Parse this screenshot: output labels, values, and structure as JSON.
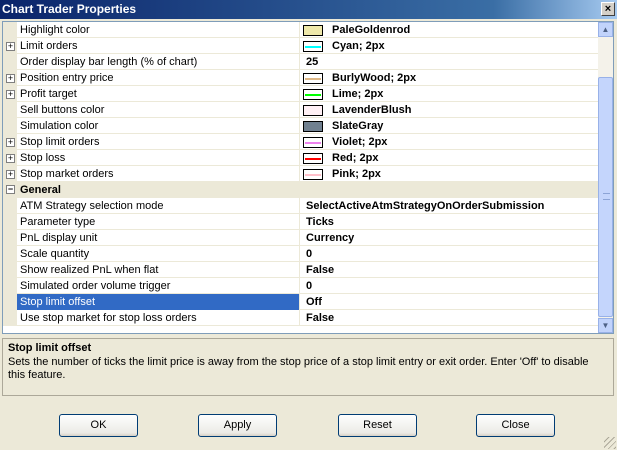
{
  "window": {
    "title": "Chart Trader Properties",
    "close_glyph": "×"
  },
  "grid": {
    "rows": [
      {
        "name": "Highlight color",
        "value": "PaleGoldenrod",
        "swatch": "#eee8aa",
        "line": null,
        "expander": ""
      },
      {
        "name": "Limit orders",
        "value": "Cyan; 2px",
        "swatch": "#ffffff",
        "line": "#00ffff",
        "expander": "+"
      },
      {
        "name": "Order display bar length (% of chart)",
        "value": "25",
        "swatch": null,
        "line": null,
        "expander": ""
      },
      {
        "name": "Position entry price",
        "value": "BurlyWood; 2px",
        "swatch": "#ffffff",
        "line": "#deb887",
        "expander": "+"
      },
      {
        "name": "Profit target",
        "value": "Lime; 2px",
        "swatch": "#ffffff",
        "line": "#00ff00",
        "expander": "+"
      },
      {
        "name": "Sell buttons color",
        "value": "LavenderBlush",
        "swatch": "#fff0f5",
        "line": null,
        "expander": ""
      },
      {
        "name": "Simulation color",
        "value": "SlateGray",
        "swatch": "#708090",
        "line": null,
        "expander": ""
      },
      {
        "name": "Stop limit orders",
        "value": "Violet; 2px",
        "swatch": "#ffffff",
        "line": "#ee82ee",
        "expander": "+"
      },
      {
        "name": "Stop loss",
        "value": "Red; 2px",
        "swatch": "#ffffff",
        "line": "#ff0000",
        "expander": "+"
      },
      {
        "name": "Stop market orders",
        "value": "Pink; 2px",
        "swatch": "#ffffff",
        "line": "#ffc0cb",
        "expander": "+"
      }
    ],
    "category": {
      "label": "General",
      "expander": "−"
    },
    "general_rows": [
      {
        "name": "ATM Strategy selection mode",
        "value": "SelectActiveAtmStrategyOnOrderSubmission"
      },
      {
        "name": "Parameter type",
        "value": "Ticks"
      },
      {
        "name": "PnL display unit",
        "value": "Currency"
      },
      {
        "name": "Scale quantity",
        "value": "0"
      },
      {
        "name": "Show realized PnL when flat",
        "value": "False"
      },
      {
        "name": "Simulated order volume trigger",
        "value": "0"
      },
      {
        "name": "Stop limit offset",
        "value": "Off",
        "selected": true
      },
      {
        "name": "Use stop market for stop loss orders",
        "value": "False"
      }
    ]
  },
  "scrollbar": {
    "up_glyph": "▲",
    "down_glyph": "▼"
  },
  "help": {
    "title": "Stop limit offset",
    "description": "Sets the number of ticks the limit price is away from the stop price of a stop limit entry or exit order. Enter 'Off' to disable this feature."
  },
  "buttons": {
    "ok": "OK",
    "apply": "Apply",
    "reset": "Reset",
    "close": "Close"
  }
}
